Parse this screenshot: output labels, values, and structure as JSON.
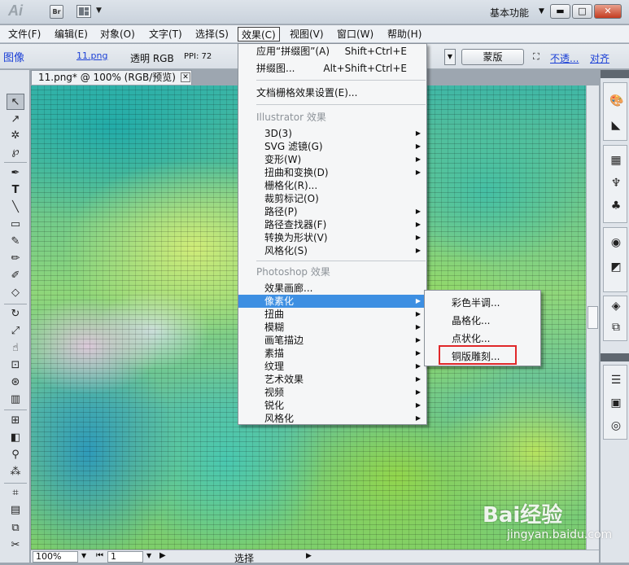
{
  "titlebar": {
    "app_logo": "Ai",
    "bridge_badge": "Br",
    "workspace": "基本功能"
  },
  "menubar": {
    "items": [
      "文件(F)",
      "编辑(E)",
      "对象(O)",
      "文字(T)",
      "选择(S)",
      "效果(C)",
      "视图(V)",
      "窗口(W)",
      "帮助(H)"
    ]
  },
  "controlbar": {
    "type_label": "图像",
    "file_link": "11.png",
    "mode": "透明 RGB",
    "ppi": "PPI: 72",
    "mask_button": "蒙版",
    "opacity_link": "不透...",
    "align_link": "对齐"
  },
  "document_tab": {
    "title": "11.png* @ 100% (RGB/预览)",
    "close": "✕"
  },
  "effect_menu": {
    "apply_last": {
      "label": "应用“拼缀图”(A)",
      "shortcut": "Shift+Ctrl+E"
    },
    "last_effect": {
      "label": "拼缀图...",
      "shortcut": "Alt+Shift+Ctrl+E"
    },
    "raster_settings": "文档栅格效果设置(E)...",
    "illustrator_header": "Illustrator 效果",
    "illustrator_items": [
      "3D(3)",
      "SVG 滤镜(G)",
      "变形(W)",
      "扭曲和变换(D)",
      "栅格化(R)...",
      "裁剪标记(O)",
      "路径(P)",
      "路径查找器(F)",
      "转换为形状(V)",
      "风格化(S)"
    ],
    "photoshop_header": "Photoshop 效果",
    "photoshop_items": [
      "效果画廊...",
      "像素化",
      "扭曲",
      "模糊",
      "画笔描边",
      "素描",
      "纹理",
      "艺术效果",
      "视频",
      "锐化",
      "风格化"
    ],
    "highlighted": "像素化"
  },
  "pixelate_submenu": {
    "items": [
      "彩色半调...",
      "晶格化...",
      "点状化...",
      "铜版雕刻..."
    ],
    "highlighted": "铜版雕刻..."
  },
  "statusbar": {
    "zoom": "100%",
    "page": "1",
    "mode": "选择"
  },
  "watermark": {
    "brand": "Bai经验",
    "url": "jingyan.baidu.com"
  },
  "icons": {
    "tools": [
      "selection-tool-icon",
      "direct-selection-tool-icon",
      "magic-wand-icon",
      "lasso-icon",
      "pen-tool-icon",
      "type-tool-icon",
      "line-tool-icon",
      "rectangle-tool-icon",
      "paintbrush-icon",
      "pencil-icon",
      "blob-brush-icon",
      "eraser-icon",
      "rotate-tool-icon",
      "scale-tool-icon",
      "warp-tool-icon",
      "free-transform-icon",
      "symbol-sprayer-icon",
      "graph-tool-icon",
      "mesh-tool-icon",
      "gradient-tool-icon",
      "eyedropper-icon",
      "blend-tool-icon",
      "slice-tool-icon",
      "column-graph-icon",
      "artboard-tool-icon",
      "scissors-icon"
    ],
    "panels": [
      "color-panel-icon",
      "color-guide-icon",
      "swatches-icon",
      "brushes-icon",
      "symbols-icon",
      "stroke-icon",
      "gradient-panel-icon",
      "layers-icon",
      "artboards-icon",
      "align-panel-icon",
      "transparency-icon",
      "appearance-icon"
    ]
  }
}
